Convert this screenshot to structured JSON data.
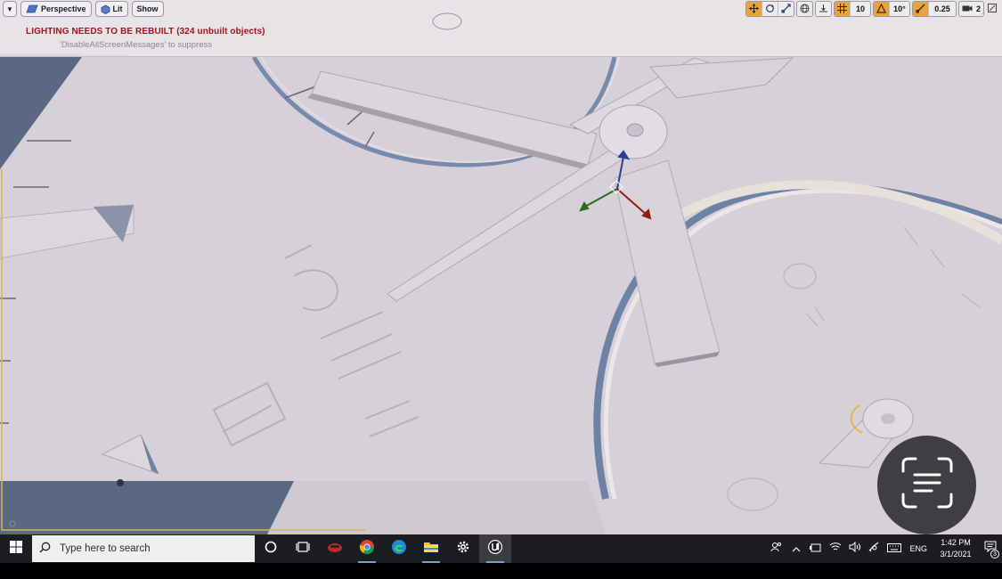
{
  "viewport": {
    "menu_icon": "dropdown-arrow-icon",
    "perspective_label": "Perspective",
    "lit_label": "Lit",
    "show_label": "Show",
    "warning_text": "LIGHTING NEEDS TO BE REBUILT (324 unbuilt objects)",
    "suppress_text": "'DisableAllScreenMessages' to suppress",
    "grid_snap_value": "10",
    "rotation_snap_value": "10°",
    "scale_snap_value": "0.25",
    "camera_speed_value": "2",
    "accent_color": "#e7a33c",
    "warning_color": "#a4161a"
  },
  "taskbar": {
    "search_placeholder": "Type here to search",
    "language": "ENG",
    "time": "1:42 PM",
    "date": "3/1/2021",
    "notification_count": "3"
  }
}
